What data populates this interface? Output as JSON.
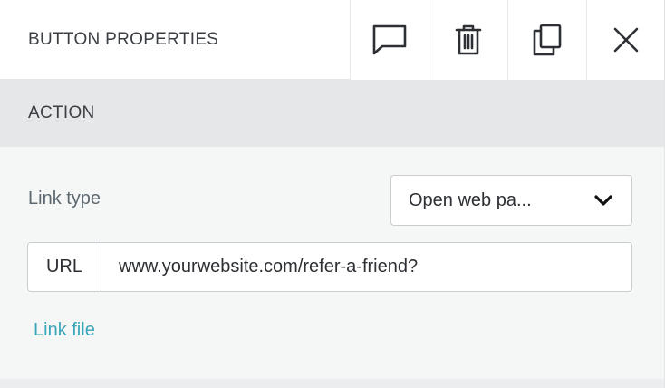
{
  "header": {
    "title": "BUTTON PROPERTIES",
    "actions": [
      {
        "name": "comment",
        "icon": "comment-icon"
      },
      {
        "name": "delete",
        "icon": "trash-icon"
      },
      {
        "name": "duplicate",
        "icon": "copy-icon"
      },
      {
        "name": "close",
        "icon": "close-icon"
      }
    ]
  },
  "section": {
    "title": "ACTION",
    "link_type_label": "Link type",
    "link_type_value": "Open web pa...",
    "url_prefix": "URL",
    "url_value": "www.yourwebsite.com/refer-a-friend?",
    "link_file_label": "Link file"
  },
  "colors": {
    "link_accent": "#3aa6b9",
    "section_header_bg": "#e6e7e8",
    "body_bg": "#f5f7f6",
    "text": "#3b3f44"
  }
}
